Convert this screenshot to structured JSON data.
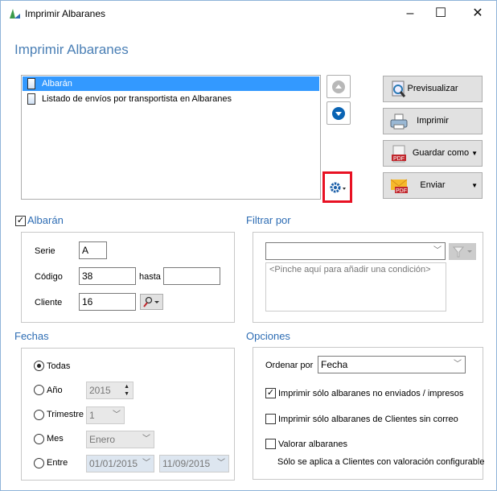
{
  "window": {
    "title": "Imprimir Albaranes",
    "minimize": "–",
    "maximize": "☐",
    "close": "✕"
  },
  "heading": "Imprimir Albaranes",
  "reports": [
    {
      "label": "Albarán",
      "selected": true
    },
    {
      "label": "Listado de envíos por transportista en Albaranes",
      "selected": false
    }
  ],
  "buttons": {
    "preview": "Previsualizar",
    "print": "Imprimir",
    "save_as": "Guardar como",
    "send": "Enviar"
  },
  "albaran": {
    "title": "Albarán",
    "checked": true,
    "serie_label": "Serie",
    "serie": "A",
    "codigo_label": "Código",
    "codigo": "38",
    "hasta_label": "hasta",
    "hasta": "",
    "cliente_label": "Cliente",
    "cliente": "16"
  },
  "filtrar": {
    "title": "Filtrar por",
    "combo": "",
    "condition_placeholder": "<Pinche aquí para añadir una condición>"
  },
  "fechas": {
    "title": "Fechas",
    "todas": "Todas",
    "anio": "Año",
    "anio_value": "2015",
    "trimestre": "Trimestre",
    "trimestre_value": "1",
    "mes": "Mes",
    "mes_value": "Enero",
    "entre": "Entre",
    "desde": "01/01/2015",
    "hasta": "11/09/2015",
    "selected": "Todas"
  },
  "opciones": {
    "title": "Opciones",
    "ordenar_label": "Ordenar por",
    "ordenar_value": "Fecha",
    "opt1": "Imprimir sólo albaranes no enviados / impresos",
    "opt1_checked": true,
    "opt2": "Imprimir sólo albaranes de Clientes sin correo",
    "opt2_checked": false,
    "opt3": "Valorar albaranes",
    "opt3_checked": false,
    "note": "Sólo se aplica a Clientes con valoración configurable"
  },
  "colors": {
    "accent": "#2e6db4",
    "selection": "#3399ff",
    "highlight": "#e81123"
  }
}
